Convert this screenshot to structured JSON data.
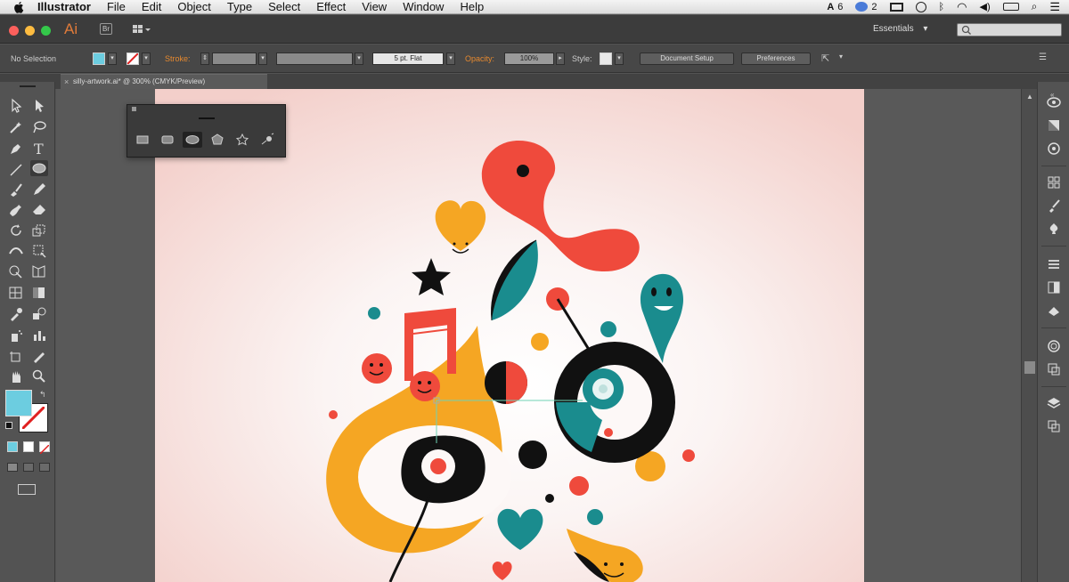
{
  "menubar": {
    "items": [
      "Illustrator",
      "File",
      "Edit",
      "Object",
      "Type",
      "Select",
      "Effect",
      "View",
      "Window",
      "Help"
    ],
    "status_a": "6",
    "status_b": "2"
  },
  "appbar": {
    "logo": "Ai",
    "bridge_label": "Br",
    "workspace": "Essentials",
    "workspace_arrow": "▾"
  },
  "controlbar": {
    "selection_label": "No Selection",
    "stroke_label": "Stroke:",
    "brush_label": "5 pt. Flat",
    "opacity_label": "Opacity:",
    "opacity_value": "100%",
    "style_label": "Style:",
    "document_setup": "Document Setup",
    "preferences": "Preferences"
  },
  "tabbar": {
    "doc_title": "silly-artwork.ai* @ 300% (CMYK/Preview)",
    "close": "×"
  },
  "colors": {
    "fill": "#6ccde0",
    "red": "#ef4a3c",
    "orange": "#f5a623",
    "teal": "#1a8c8e",
    "black": "#111111"
  },
  "icons": {
    "tools": [
      "selection",
      "direct-selection",
      "magic-wand",
      "lasso",
      "pen",
      "type",
      "line-segment",
      "ellipse",
      "paintbrush",
      "pencil",
      "blob-brush",
      "eraser",
      "rotate",
      "scale",
      "width",
      "free-transform",
      "shape-builder",
      "perspective-grid",
      "mesh",
      "gradient",
      "eyedropper",
      "blend",
      "symbol-sprayer",
      "column-graph",
      "artboard",
      "slice",
      "hand",
      "zoom"
    ],
    "shape_panel": [
      "rectangle",
      "rounded-rectangle",
      "ellipse",
      "polygon",
      "star",
      "flare"
    ],
    "dock": [
      "color-guide",
      "gradient",
      "transparency",
      "align",
      "brushes",
      "symbols",
      "stroke",
      "graphic-styles",
      "appearance",
      "pathfinder",
      "layers",
      "artboards"
    ]
  }
}
